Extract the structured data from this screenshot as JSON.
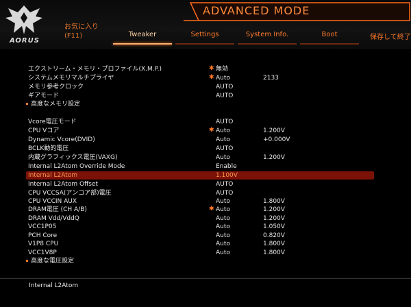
{
  "header": {
    "logo_text": "AORUS",
    "mode_title": "ADVANCED MODE",
    "favorites_label": "お気に入り",
    "favorites_key": "(F11)",
    "save_exit_label": "保存して終了"
  },
  "tabs": [
    {
      "label": "Tweaker",
      "active": true
    },
    {
      "label": "Settings",
      "active": false
    },
    {
      "label": "System Info.",
      "active": false
    },
    {
      "label": "Boot",
      "active": false
    }
  ],
  "rows": [
    {
      "label": "エクストリーム・メモリ・プロファイル(X.M.P.)",
      "star": true,
      "value": "無効",
      "value2": ""
    },
    {
      "label": "システムメモリマルチプライヤ",
      "star": true,
      "value": "Auto",
      "value2": "2133"
    },
    {
      "label": "メモリ参考クロック",
      "star": false,
      "value": "AUTO",
      "value2": ""
    },
    {
      "label": "ギアモード",
      "star": false,
      "value": "AUTO",
      "value2": ""
    },
    {
      "label": "高度なメモリ設定",
      "star": false,
      "value": "",
      "value2": "",
      "submenu": true
    },
    {
      "label": "Vcore電圧モード",
      "star": false,
      "value": "AUTO",
      "value2": ""
    },
    {
      "label": "CPU Vコア",
      "star": true,
      "value": "Auto",
      "value2": "1.200V"
    },
    {
      "label": "Dynamic Vcore(DVID)",
      "star": false,
      "value": "Auto",
      "value2": "+0.000V"
    },
    {
      "label": "BCLK動的電圧",
      "star": false,
      "value": "AUTO",
      "value2": ""
    },
    {
      "label": "内蔵グラフィックス電圧(VAXG)",
      "star": false,
      "value": "Auto",
      "value2": "1.200V"
    },
    {
      "label": "Internal L2Atom Override Mode",
      "star": false,
      "value": "Enable",
      "value2": ""
    },
    {
      "label": "Internal L2Atom",
      "star": false,
      "value": "1.100V",
      "value2": "",
      "selected": true
    },
    {
      "label": "Internal L2Atom Offset",
      "star": false,
      "value": "AUTO",
      "value2": ""
    },
    {
      "label": "CPU VCCSA(アンコア部)電圧",
      "star": false,
      "value": "AUTO",
      "value2": ""
    },
    {
      "label": "CPU VCCIN AUX",
      "star": false,
      "value": "Auto",
      "value2": "1.800V"
    },
    {
      "label": "DRAM電圧 (CH A/B)",
      "star": true,
      "value": "Auto",
      "value2": "1.200V"
    },
    {
      "label": "DRAM Vdd/VddQ",
      "star": false,
      "value": "Auto",
      "value2": "1.200V"
    },
    {
      "label": "VCC1P05",
      "star": false,
      "value": "Auto",
      "value2": "1.050V"
    },
    {
      "label": "PCH Core",
      "star": false,
      "value": "Auto",
      "value2": "0.820V"
    },
    {
      "label": "V1P8 CPU",
      "star": false,
      "value": "Auto",
      "value2": "1.800V"
    },
    {
      "label": "VCC1V8P",
      "star": false,
      "value": "Auto",
      "value2": "1.800V"
    },
    {
      "label": "高度な電圧設定",
      "star": false,
      "value": "",
      "value2": "",
      "submenu": true
    }
  ],
  "footer": {
    "help_text": "Internal L2Atom"
  },
  "colors": {
    "accent": "#ff7a2a",
    "selected_bg": "#7a1208",
    "background": "#000000"
  }
}
